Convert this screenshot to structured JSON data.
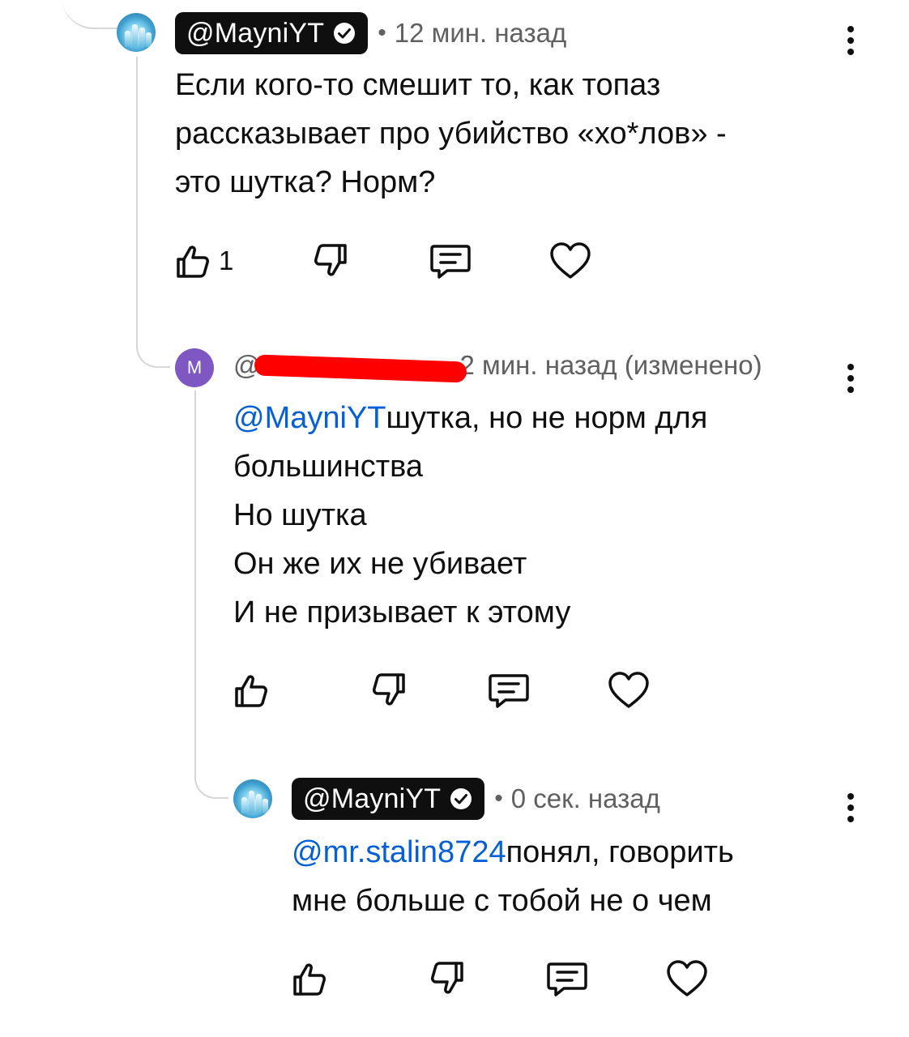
{
  "comments": [
    {
      "author": "@MayniYT",
      "verified": true,
      "time": "12 мин. назад",
      "lines": [
        "Если кого-то смешит то, как топаз",
        "рассказывает про убийство «хо*лов» -",
        "это шутка? Норм?"
      ],
      "likes": "1"
    },
    {
      "avatar_letter": "M",
      "author_visible": "@",
      "time": "2 мин. назад (изменено)",
      "mention": "@MayniYT",
      "lines": [
        "шутка, но не норм для",
        "большинства",
        "Но шутка",
        "Он же их не убивает",
        "И не призывает к этому"
      ]
    },
    {
      "author": "@MayniYT",
      "verified": true,
      "time": "0 сек. назад",
      "mention": "@mr.stalin8724",
      "lines": [
        "понял, говорить",
        "мне больше с тобой не о чем"
      ]
    }
  ],
  "icons": {
    "like": "thumbs-up-icon",
    "dislike": "thumbs-down-icon",
    "reply": "reply-comment-icon",
    "heart": "heart-icon",
    "more": "more-vert-icon",
    "verified": "verified-check-icon"
  },
  "colors": {
    "mention": "#065fd4",
    "chip": "#0f0f0f",
    "meta": "#606060",
    "avatar_letter_bg": "#7e57c2",
    "redaction": "#ff0000"
  }
}
